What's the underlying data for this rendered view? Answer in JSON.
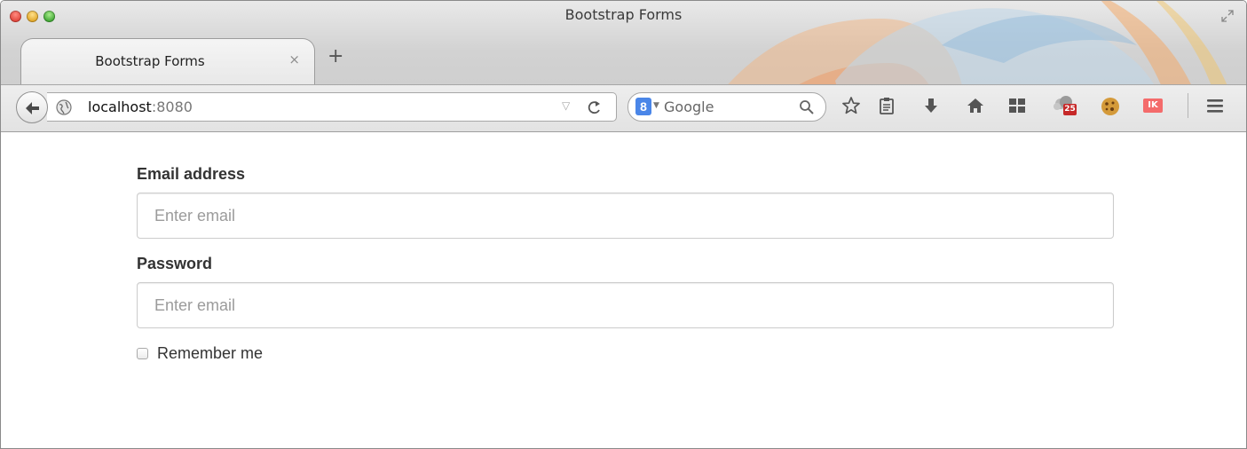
{
  "window": {
    "title": "Bootstrap Forms"
  },
  "tabs": [
    {
      "label": "Bootstrap Forms",
      "close_glyph": "×"
    }
  ],
  "new_tab_glyph": "+",
  "toolbar": {
    "url_host": "localhost",
    "url_port": ":8080",
    "dropdown_glyph": "▽",
    "search_engine_glyph": "8",
    "search_engine_arrow": "▼",
    "search_placeholder": "Google",
    "icons": [
      "back-arrow-icon",
      "globe-icon",
      "reload-icon",
      "google-engine-icon",
      "search-icon",
      "bookmark-star-icon",
      "reading-list-icon",
      "downloads-icon",
      "home-icon",
      "apps-grid-icon",
      "calendar-extension-icon",
      "cookie-extension-icon",
      "extension-icon",
      "menu-icon"
    ],
    "calendar_badge": "25",
    "extension_badge": "IK"
  },
  "form": {
    "email": {
      "label": "Email address",
      "placeholder": "Enter email",
      "value": ""
    },
    "password": {
      "label": "Password",
      "placeholder": "Enter email",
      "value": ""
    },
    "remember": {
      "label": "Remember me",
      "checked": false
    }
  },
  "colors": {
    "label_text": "#333333",
    "input_border": "#cccccc",
    "placeholder": "#999999",
    "search_engine": "#4a86e8",
    "traffic_red": "#e0443a",
    "traffic_yellow": "#e0a526",
    "traffic_green": "#3ea533"
  }
}
